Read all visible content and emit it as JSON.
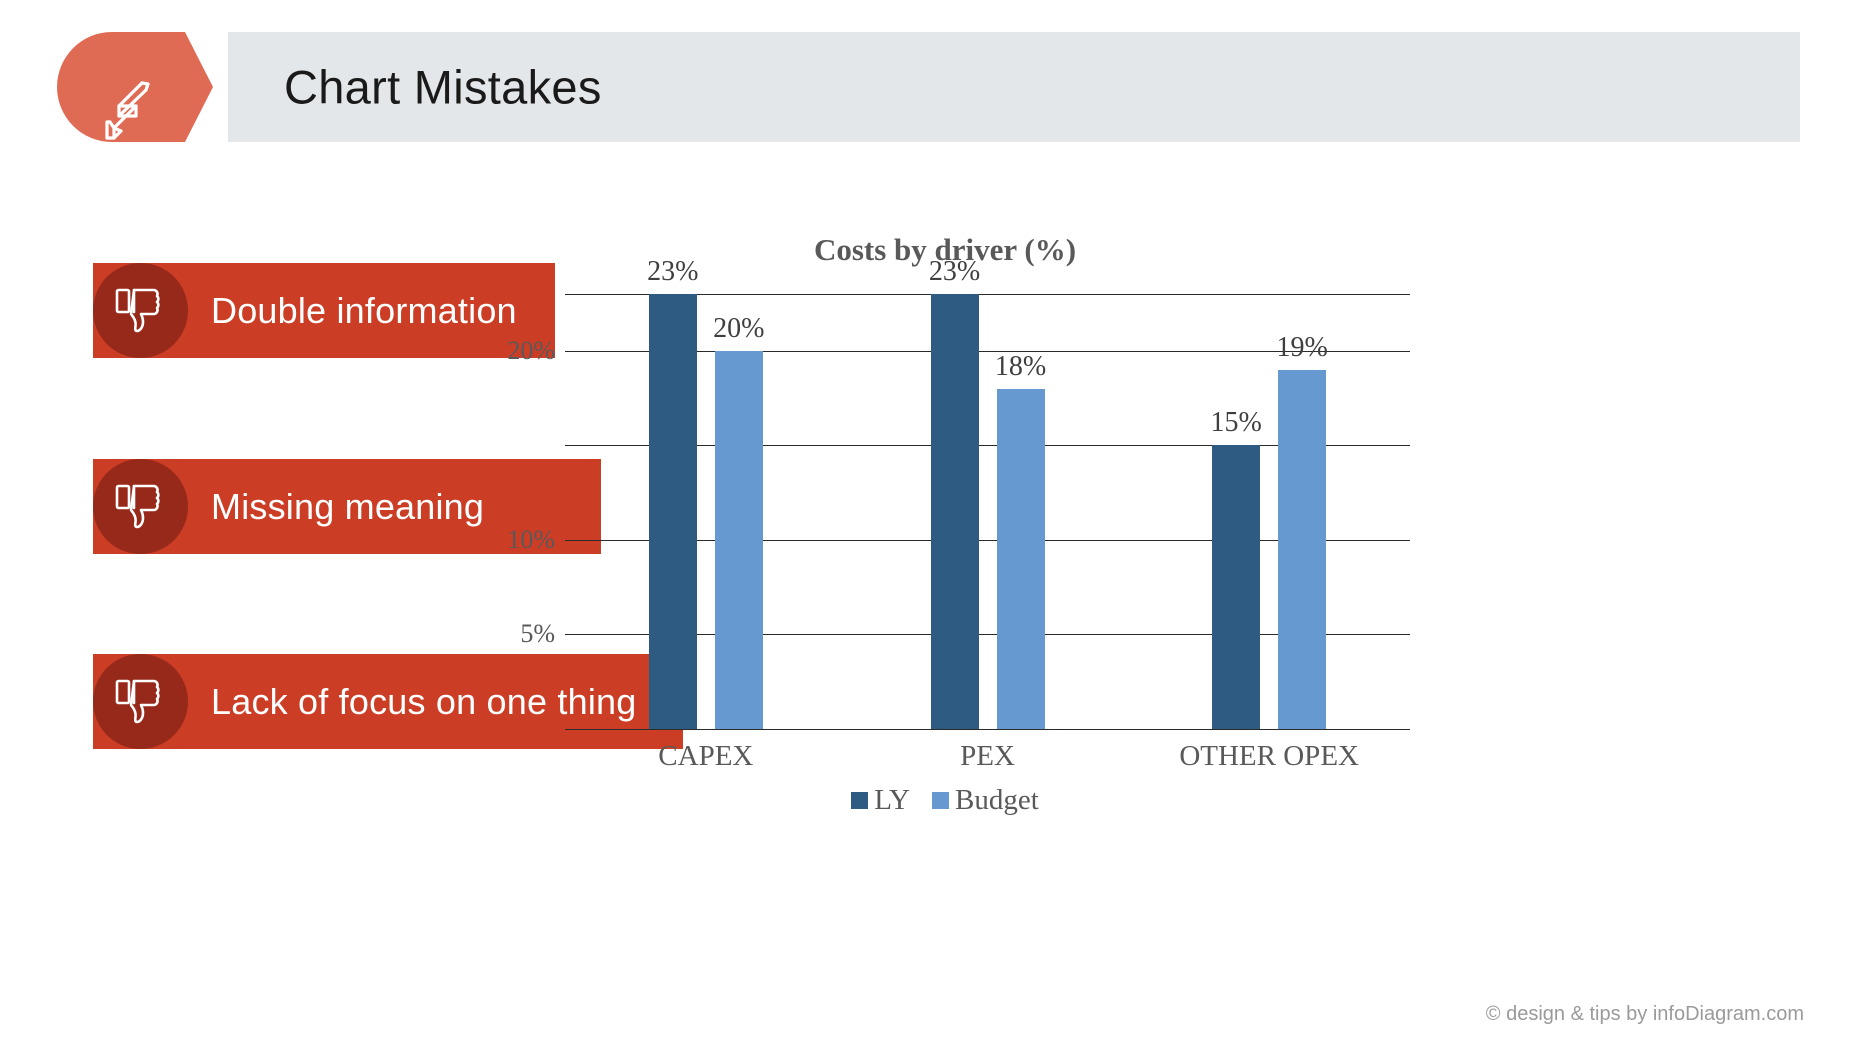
{
  "header": {
    "title": "Chart Mistakes",
    "icon": "lightning-bolt-icon",
    "badge_color": "#E06B55",
    "bar_color": "#E4E7EA"
  },
  "mistakes": {
    "icon": "thumbs-down-icon",
    "bar_color": "#CC3D26",
    "circle_color": "#96291A",
    "items": [
      {
        "label": "Double information"
      },
      {
        "label": "Missing meaning"
      },
      {
        "label": "Lack of focus on one thing"
      }
    ]
  },
  "chart_data": {
    "type": "bar",
    "title": "Costs by driver (%)",
    "xlabel": "",
    "ylabel": "",
    "categories": [
      "CAPEX",
      "PEX",
      "OTHER OPEX"
    ],
    "series": [
      {
        "name": "LY",
        "color": "#2E5B82",
        "values": [
          23,
          23,
          15
        ],
        "labels": [
          "23%",
          "23%",
          "15%"
        ]
      },
      {
        "name": "Budget",
        "color": "#6699D0",
        "values": [
          20,
          18,
          19
        ],
        "labels": [
          "20%",
          "18%",
          "19%"
        ]
      }
    ],
    "ylim": [
      0,
      23
    ],
    "yticks": [
      5,
      10,
      20
    ],
    "ytick_labels": [
      "5%",
      "10%",
      "20%"
    ],
    "gridlines": [
      0,
      5,
      10,
      15,
      20,
      23
    ],
    "grid": true,
    "legend_position": "bottom",
    "legend": [
      "LY",
      "Budget"
    ]
  },
  "footer": {
    "credit": "© design & tips by infoDiagram.com"
  }
}
